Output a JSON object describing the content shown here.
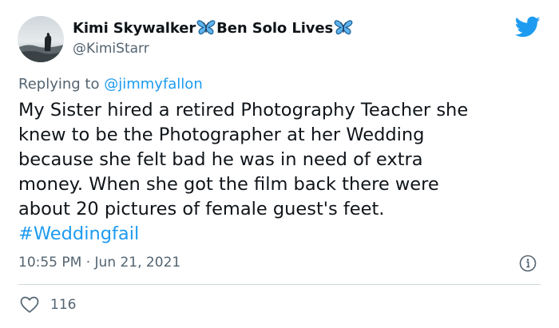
{
  "author": {
    "display_name_part1": "Kimi Skywalker",
    "display_name_part2": "Ben Solo Lives",
    "handle": "@KimiStarr"
  },
  "reply": {
    "prefix": "Replying to",
    "mention": "@jimmyfallon"
  },
  "tweet": {
    "lines": [
      "My Sister hired a retired Photography Teacher she",
      "knew to be the Photographer at her Wedding",
      "because she felt bad he was in need of extra",
      "money. When she got the film back there were",
      "about 20 pictures of female guest's feet."
    ],
    "hashtag": "#Weddingfail"
  },
  "meta": {
    "timestamp": "10:55 PM · Jun 21, 2021"
  },
  "stats": {
    "likes": "116"
  },
  "icons": {
    "brand": "twitter-bird-icon",
    "emoji": "butterfly-icon",
    "info": "info-icon",
    "like": "heart-icon"
  },
  "colors": {
    "accent": "#1d9bf0",
    "text": "#0f1419",
    "secondary": "#536471",
    "divider": "#cfd9de"
  }
}
